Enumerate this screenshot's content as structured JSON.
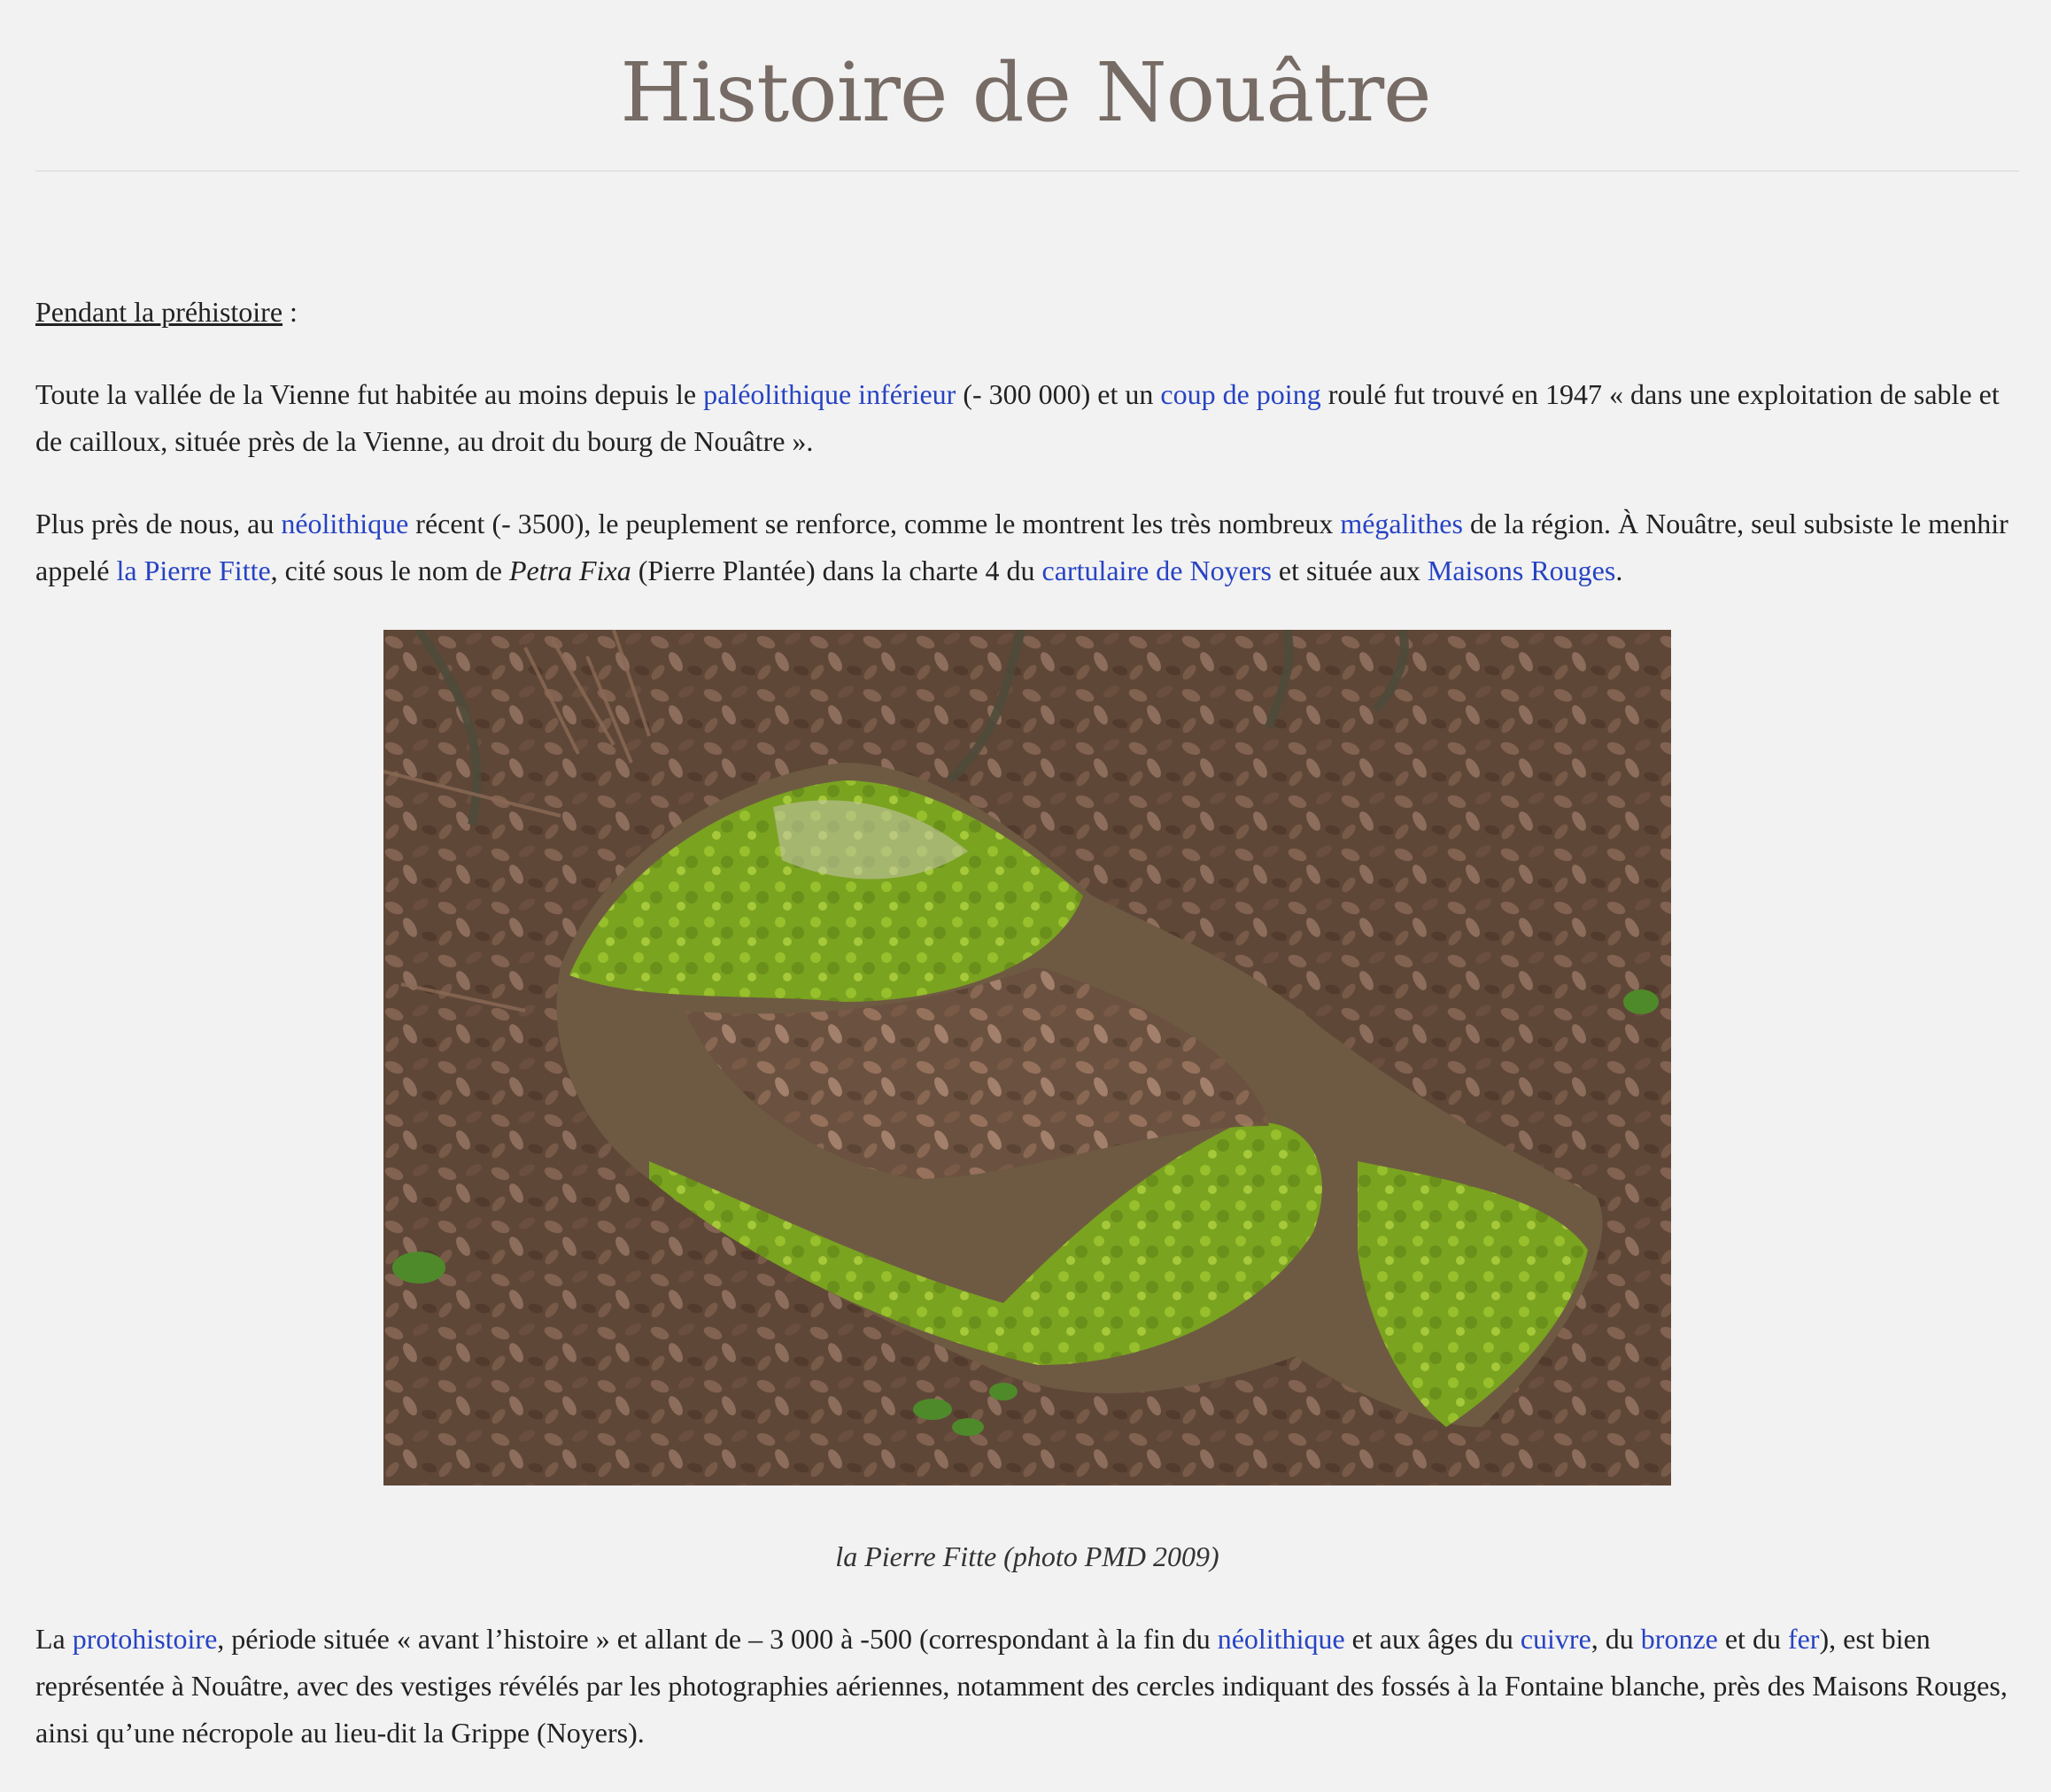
{
  "title": "Histoire de Nouâtre",
  "section_heading": {
    "label": "Pendant la préhistoire",
    "suffix": " :"
  },
  "para1": {
    "t1": "Toute la vallée de la Vienne fut habitée au moins depuis le ",
    "link1": "paléolithique inférieur",
    "t2": " (- 300 000) et un ",
    "link2": "coup de poing",
    "t3": " roulé fut trouvé en 1947 « dans une exploitation de sable et de cailloux, située près de la Vienne, au droit du bourg de Nouâtre »."
  },
  "para2": {
    "t1": "Plus près de nous, au ",
    "link1": "néolithique",
    "t2": " récent (- 3500), le peuplement se renforce, comme le montrent les très nombreux ",
    "link2": "mégalithes",
    "t3": " de la région. À Nouâtre, seul subsiste le menhir appelé ",
    "link3": "la Pierre Fitte",
    "t4": ", cité sous le nom de ",
    "em": "Petra Fixa",
    "t5": " (Pierre Plantée) dans la charte 4 du ",
    "link4": "cartulaire de Noyers",
    "t6": " et située aux ",
    "link5": "Maisons Rouges",
    "t7": "."
  },
  "figure": {
    "caption": "la Pierre Fitte (photo PMD 2009)"
  },
  "para3": {
    "t1": "La ",
    "link1": "protohistoire",
    "t2": ", période située « avant l’histoire » et allant de – 3 000 à -500 (correspondant à la fin du ",
    "link2": "néolithique",
    "t3": " et aux âges du ",
    "link3": "cuivre",
    "t4": ", du ",
    "link4": "bronze",
    "t5": " et du ",
    "link5": "fer",
    "t6": "), est bien représentée à Nouâtre, avec des vestiges révélés par les photographies aériennes, notamment des cercles indiquant des fossés à la Fontaine blanche, près des Maisons Rouges, ainsi qu’une nécropole au lieu-dit la Grippe (Noyers)."
  },
  "colors": {
    "link": "#2743c3",
    "title": "#776b65",
    "background": "#f2f2f2"
  }
}
